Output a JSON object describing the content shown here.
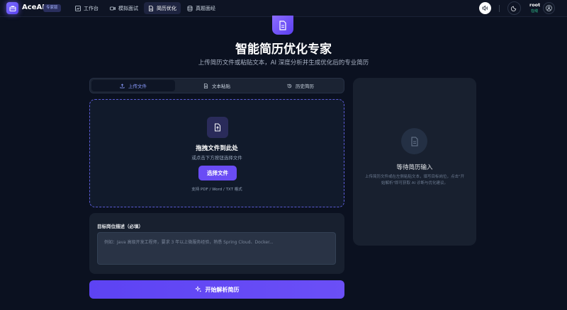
{
  "app": {
    "brand": "AceAI",
    "badge": "专家版"
  },
  "nav": {
    "items": [
      {
        "label": "工作台",
        "icon": "dashboard-icon"
      },
      {
        "label": "模拟面试",
        "icon": "video-icon"
      },
      {
        "label": "简历优化",
        "icon": "document-icon",
        "active": true
      },
      {
        "label": "真题面经",
        "icon": "database-icon"
      }
    ]
  },
  "user": {
    "name": "root",
    "status": "在线"
  },
  "hero": {
    "title": "智能简历优化专家",
    "subtitle": "上传简历文件或粘贴文本，AI 深度分析并生成优化后的专业简历"
  },
  "tabs": [
    {
      "label": "上传文件",
      "icon": "upload-icon",
      "active": true
    },
    {
      "label": "文本粘贴",
      "icon": "text-doc-icon"
    },
    {
      "label": "历史简历",
      "icon": "history-icon"
    }
  ],
  "upload": {
    "title": "拖拽文件到此处",
    "subtitle": "或点击下方按钮选择文件",
    "button": "选择文件",
    "formats": "支持 PDF / Word / TXT 格式"
  },
  "job_description": {
    "label": "目标岗位描述（必填）",
    "value": "",
    "placeholder": "例如：Java 高级开发工程师，要求 3 年以上微服务经验，熟悉 Spring Cloud、Docker..."
  },
  "submit": {
    "label": "开始解析简历"
  },
  "side_panel": {
    "title": "等待简历输入",
    "description": "上传简历文件或在左侧粘贴文本，填写目标岗位，点击\"开始解析\"即可获取 AI 诊断与优化建议。"
  },
  "colors": {
    "accent": "#6a4cf5",
    "background": "#0b1120",
    "card": "#18202f",
    "status_online": "#34d399"
  }
}
